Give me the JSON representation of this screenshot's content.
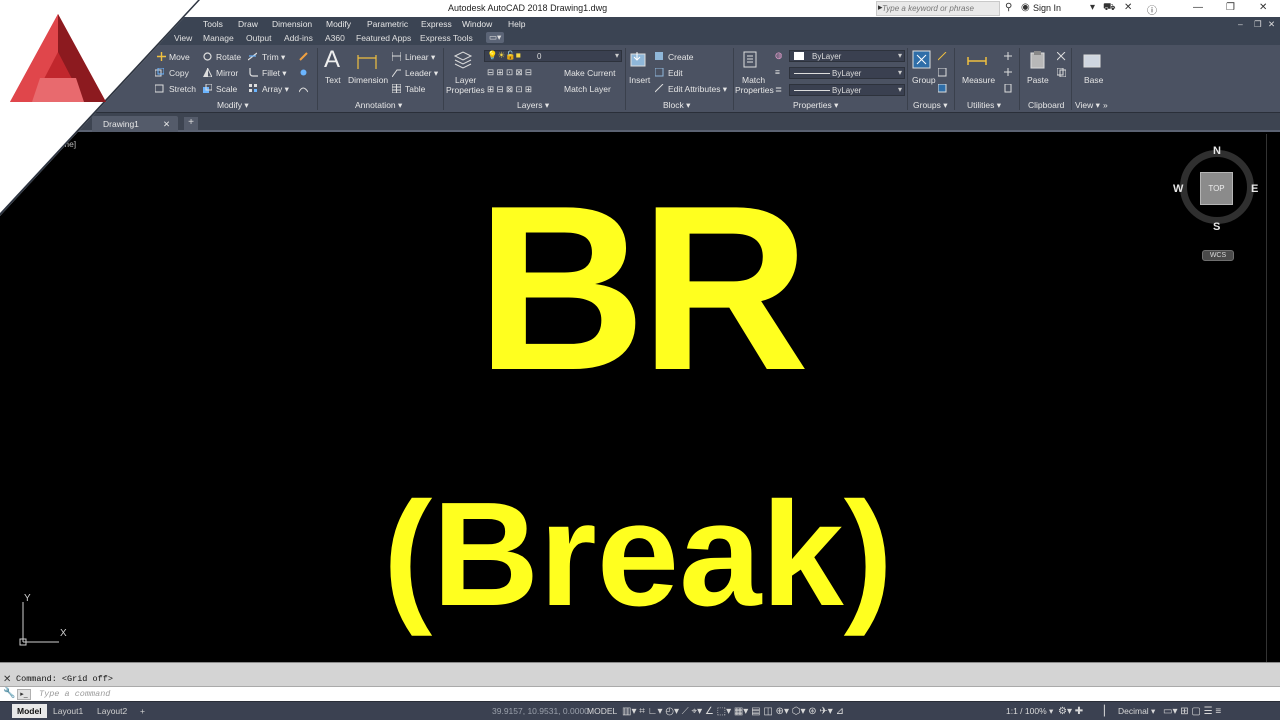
{
  "titlebar": {
    "title": "Autodesk AutoCAD 2018    Drawing1.dwg",
    "search_placeholder": "Type a keyword or phrase",
    "sign_in": "Sign In"
  },
  "menubar": [
    "Tools",
    "Draw",
    "Dimension",
    "Modify",
    "Parametric",
    "Express",
    "Window",
    "Help"
  ],
  "ribbon_tabs": [
    "View",
    "Manage",
    "Output",
    "Add-ins",
    "A360",
    "Featured Apps",
    "Express Tools"
  ],
  "ribbon": {
    "modify": {
      "group": "Modify ▾",
      "items": [
        "Move",
        "Rotate",
        "Trim ▾",
        "Copy",
        "Mirror",
        "Fillet ▾",
        "Stretch",
        "Scale",
        "Array ▾"
      ]
    },
    "annotation": {
      "group": "Annotation ▾",
      "text": "Text",
      "dimension": "Dimension",
      "linear": "Linear ▾",
      "leader": "Leader ▾",
      "table": "Table"
    },
    "layers": {
      "group": "Layers ▾",
      "layer_properties_1": "Layer",
      "layer_properties_2": "Properties",
      "current_layer": "0",
      "make_current": "Make Current",
      "match_layer": "Match Layer"
    },
    "block": {
      "group": "Block ▾",
      "insert": "Insert",
      "create": "Create",
      "edit": "Edit",
      "edit_attributes": "Edit Attributes ▾"
    },
    "properties": {
      "group": "Properties ▾",
      "match_1": "Match",
      "match_2": "Properties",
      "color": "ByLayer",
      "linetype": "ByLayer",
      "lineweight": "ByLayer"
    },
    "groups": {
      "group": "Groups ▾",
      "group_btn": "Group"
    },
    "utilities": {
      "group": "Utilities ▾",
      "measure": "Measure"
    },
    "clipboard": {
      "group": "Clipboard",
      "paste": "Paste"
    },
    "view": {
      "group": "View ▾",
      "base": "Base"
    }
  },
  "filetabs": {
    "drawing": "Drawing1",
    "new_tab": "+"
  },
  "viewport": {
    "label": "me]",
    "headline": "BR",
    "subline": "(Break)",
    "text_color": "#ffff1f"
  },
  "viewcube": {
    "n": "N",
    "s": "S",
    "e": "E",
    "w": "W",
    "face": "TOP",
    "wcs": "WCS"
  },
  "ucs": {
    "y": "Y",
    "x": "X"
  },
  "command": {
    "history": "Command:  <Grid off>",
    "placeholder": "Type a command"
  },
  "statusbar": {
    "layouts": [
      "Model",
      "Layout1",
      "Layout2"
    ],
    "coords": "39.9157, 10.9531, 0.0000",
    "space": "MODEL",
    "scale": "1:1 / 100% ▾",
    "units": "Decimal ▾"
  }
}
